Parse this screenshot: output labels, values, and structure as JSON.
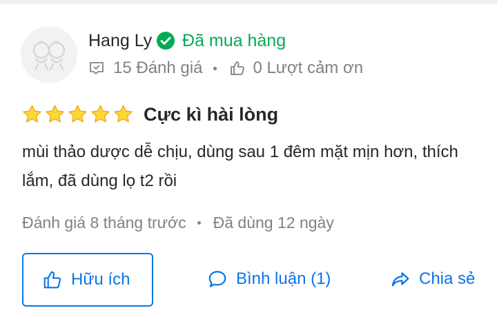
{
  "user": {
    "name": "Hang Ly",
    "purchased_label": "Đã mua hàng",
    "reviews_count": "15 Đánh giá",
    "thanks_count": "0 Lượt cảm ơn"
  },
  "review": {
    "stars": 5,
    "max_stars": 5,
    "rating_label": "Cực kì hài lòng",
    "text": "mùi thảo dược dễ chịu, dùng sau 1 đêm mặt mịn hơn, thích lắm, đã dùng lọ t2 rồi",
    "posted": "Đánh giá 8 tháng trước",
    "usage": "Đã dùng 12 ngày"
  },
  "actions": {
    "helpful_label": "Hữu ích",
    "comment_label": "Bình luận (1)",
    "share_label": "Chia sẻ"
  },
  "colors": {
    "accent": "#0b74e5",
    "verified": "#00ab56",
    "star": "#fdd836",
    "muted": "#808089",
    "text": "#27272a"
  },
  "icons": {
    "avatar": "avatar-placeholder-icon",
    "verified": "check-circle-icon",
    "reviews": "review-chat-icon",
    "thanks": "thumbs-up-icon",
    "star": "star-icon",
    "comment": "comment-bubble-icon",
    "share": "share-arrow-icon"
  }
}
